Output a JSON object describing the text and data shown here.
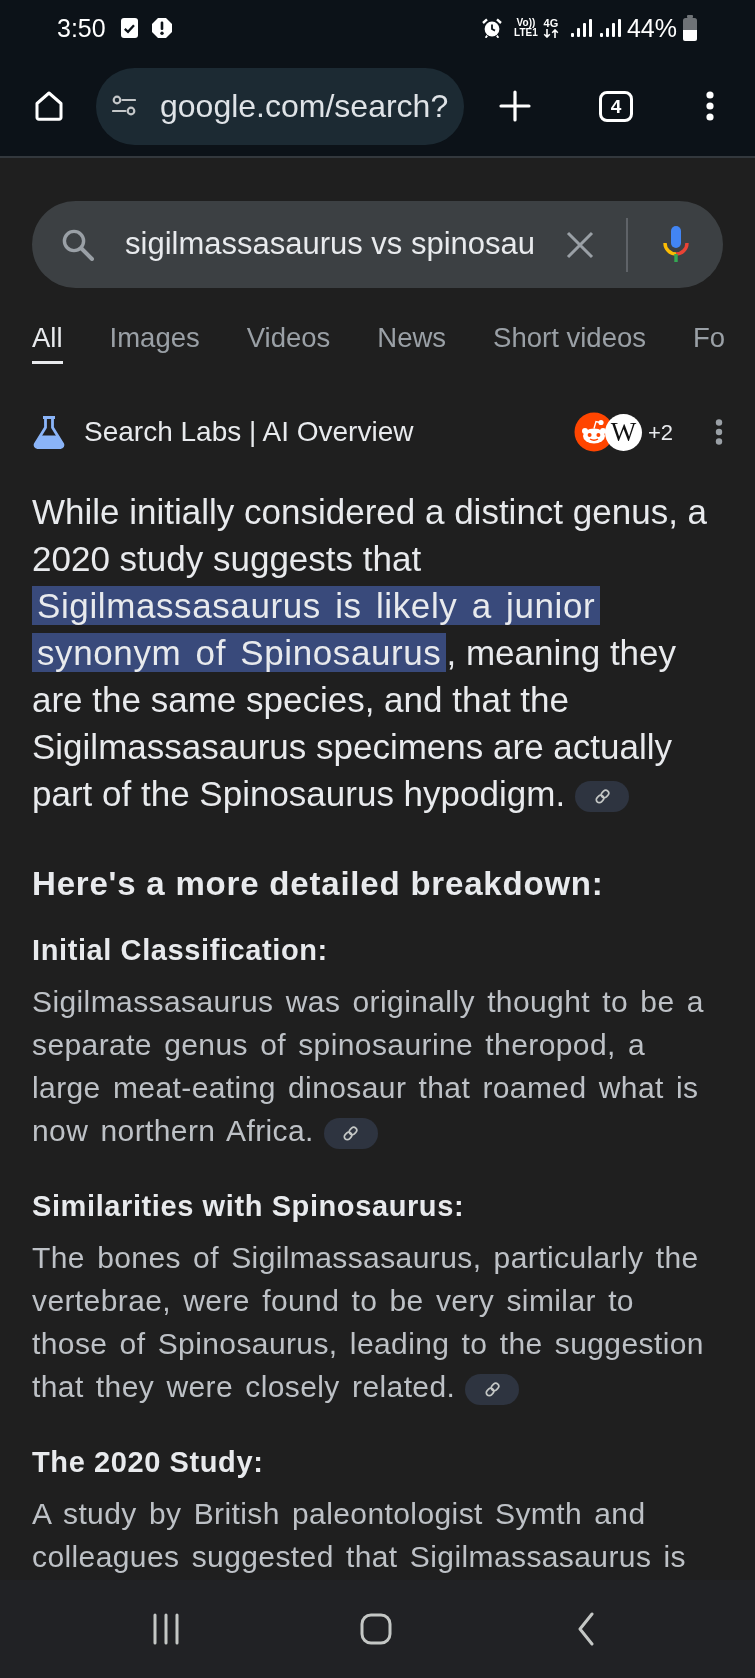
{
  "status_bar": {
    "time": "3:50",
    "volte": "Vo)) LTE1",
    "network": "4G",
    "battery": "44%"
  },
  "browser_toolbar": {
    "url": "google.com/search?",
    "tab_count": "4"
  },
  "search": {
    "value": "sigilmassasaurus vs spinosau"
  },
  "tabs": [
    {
      "label": "All",
      "selected": true
    },
    {
      "label": "Images",
      "selected": false
    },
    {
      "label": "Videos",
      "selected": false
    },
    {
      "label": "News",
      "selected": false
    },
    {
      "label": "Short videos",
      "selected": false
    },
    {
      "label": "Fo",
      "selected": false
    }
  ],
  "ai_overview": {
    "title": "Search Labs | AI Overview",
    "sources": [
      {
        "kind": "face"
      },
      {
        "kind": "letter",
        "text": "W"
      }
    ],
    "more_sources": "+2",
    "summary": {
      "segments": [
        {
          "text": "While initially considered a distinct genus, a 2020 study suggests that ",
          "highlighted": false
        },
        {
          "text": "Sigilmassasaurus is likely a junior synonym of Spinosaurus",
          "highlighted": true
        },
        {
          "text": ", meaning they are the same species, and that the Sigilmassasaurus specimens are actually part of the Spinosaurus hypodigm.",
          "highlighted": false
        }
      ],
      "source_link": true
    },
    "breakdown_title": "Here's a more detailed breakdown:",
    "sections": [
      {
        "heading": "Initial Classification:",
        "text": "Sigilmassasaurus was originally thought to be a separate genus of spinosaurine theropod, a large meat-eating dinosaur that roamed what is now northern Africa.",
        "source_link": true
      },
      {
        "heading": "Similarities with Spinosaurus:",
        "text": "The bones of Sigilmassasaurus, particularly the vertebrae, were found to be very similar to those of Spinosaurus, leading to the suggestion that they were closely related.",
        "source_link": true
      },
      {
        "heading": "The 2020 Study:",
        "text": "A study by British paleontologist Symth and colleagues suggested that Sigilmassasaurus is",
        "source_link": false
      }
    ]
  }
}
